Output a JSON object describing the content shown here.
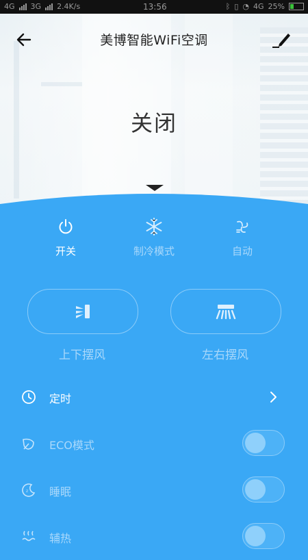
{
  "statusbar": {
    "sim1": "4G",
    "sim2": "3G",
    "speed": "2.4K/s",
    "time": "13:56",
    "network": "4G",
    "battery": "25%"
  },
  "header": {
    "title": "美博智能WiFi空调",
    "back_icon": "arrow-left-icon",
    "edit_icon": "pencil-icon"
  },
  "device": {
    "power_state": "关闭"
  },
  "modes": [
    {
      "label": "开关",
      "icon": "power-icon",
      "active": true
    },
    {
      "label": "制冷模式",
      "icon": "snowflake-icon",
      "active": false
    },
    {
      "label": "自动",
      "icon": "fan-icon",
      "active": false
    }
  ],
  "swing": {
    "vertical_label": "上下摆风",
    "horizontal_label": "左右摆风"
  },
  "settings": {
    "timer_label": "定时",
    "eco_label": "ECO模式",
    "eco_on": false,
    "sleep_label": "睡眠",
    "sleep_on": false,
    "heat_label": "辅热",
    "heat_on": false
  },
  "colors": {
    "panel": "#3aa8f5",
    "active_text": "#ffffff",
    "dim_text": "#a9d8fb"
  }
}
